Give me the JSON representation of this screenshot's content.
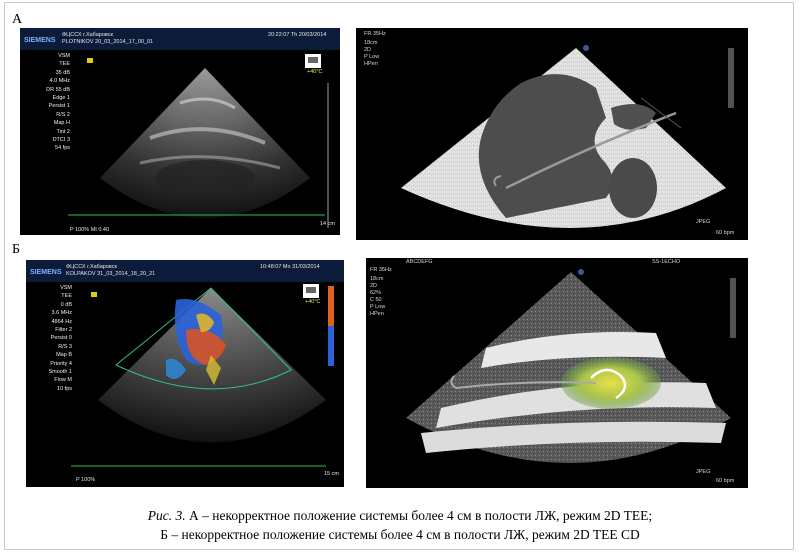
{
  "panels": {
    "a_label": "А",
    "b_label": "Б"
  },
  "us_a": {
    "brand": "SIEMENS",
    "header_line1": "ФЦССХ г.Хабаровск",
    "header_line2": "PLOTNIKOV        20_03_2014_17_00_01",
    "datetime": "20:22:07  Th  20/03/2014",
    "temperature": "+40°C",
    "params": [
      "VSM",
      "TEE",
      "35 dB",
      "4.0 MHz",
      "DR 55 dB",
      "Edge 1",
      "Persist 1",
      "R/S 2",
      "Map H",
      "Tint 2",
      "DTCI 3",
      "54 fps"
    ],
    "footer": "P 100%    MI 0.40",
    "depth": "14 cm"
  },
  "us_b": {
    "brand": "SIEMENS",
    "header_line1": "ФЦССХ г.Хабаровск",
    "header_line2": "KOLPAKOV        31_03_2014_18_20_21",
    "datetime": "10:48:07  Mo  31/03/2014",
    "temperature": "+40°C",
    "params": [
      "VSM",
      "TEE",
      "0 dB",
      "3.6 MHz",
      "4864 Hz",
      "Filter 2",
      "Persist 0",
      "R/S 3",
      "Map B",
      "Priority 4",
      "Smooth 1",
      "Flow M",
      "10 fps"
    ],
    "footer": "P 100%",
    "depth": "15 cm"
  },
  "sim_a": {
    "top_label": "FR 35Hz",
    "side_labels": [
      "18cm",
      "2D",
      "P Low",
      "HPen"
    ],
    "bottom_right": "60 bpm",
    "jpeg": "JPEG"
  },
  "sim_b": {
    "top_left": "ABCDEFG",
    "top_right": "SS-1ECHO",
    "top_label": "FR 35Hz",
    "side_labels": [
      "18cm",
      "2D",
      "62%",
      "C 50",
      "P Low",
      "HPen"
    ],
    "bottom_right": "60 bpm",
    "jpeg": "JPEG"
  },
  "caption": {
    "fig_label": "Рис. 3.",
    "line1": " А – некорректное положение системы более 4 см в полости ЛЖ, режим 2D TEE;",
    "line2": "Б – некорректное положение системы более 4 см в полости ЛЖ, режим 2D TEE CD"
  }
}
